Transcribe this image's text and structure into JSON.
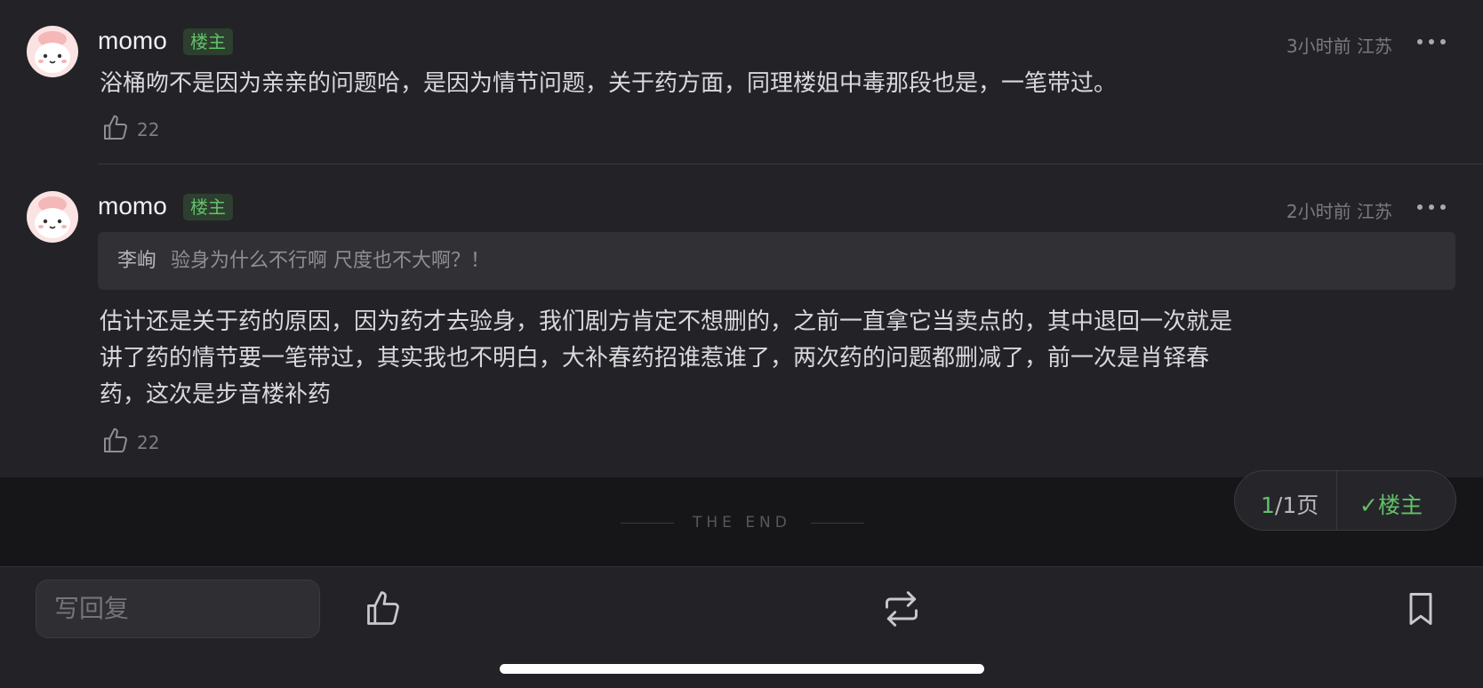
{
  "comments": [
    {
      "name": "momo",
      "badge": "楼主",
      "meta": "3小时前 江苏",
      "text": "浴桶吻不是因为亲亲的问题哈，是因为情节问题，关于药方面，同理楼姐中毒那段也是，一笔带过。",
      "likes": "22"
    },
    {
      "name": "momo",
      "badge": "楼主",
      "meta": "2小时前 江苏",
      "quote_name": "李峋",
      "quote_text": "验身为什么不行啊 尺度也不大啊？！",
      "text_lines": [
        "估计还是关于药的原因，因为药才去验身，我们剧方肯定不想删的，之前一直拿它当卖点的，其中退回一次就是",
        "讲了药的情节要一笔带过，其实我也不明白，大补春药招谁惹谁了，两次药的问题都删减了，前一次是肖铎春",
        "药，这次是步音楼补药"
      ],
      "likes": "22"
    }
  ],
  "end_text": "THE END",
  "pager": {
    "current": "1",
    "total": "/1页",
    "filter": "✓楼主"
  },
  "bottom_bar": {
    "reply_placeholder": "写回复",
    "icons": [
      "thumbs-up-icon",
      "repost-icon",
      "bookmark-icon"
    ]
  },
  "colors": {
    "accent": "#62c06a",
    "background": "#232327",
    "footer_bg": "#161619"
  }
}
